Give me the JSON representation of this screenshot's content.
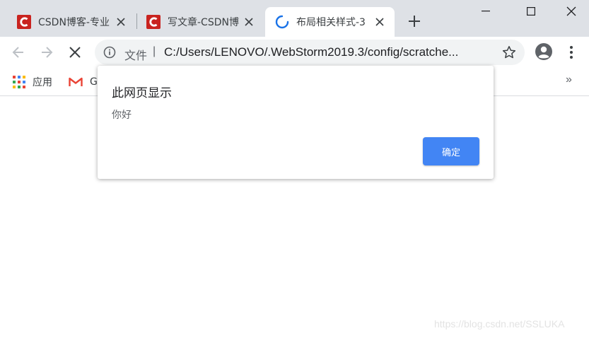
{
  "tabs": [
    {
      "title": "CSDN博客-专业",
      "favicon": "csdn-logo-icon",
      "active": false
    },
    {
      "title": "写文章-CSDN博",
      "favicon": "csdn-logo-icon",
      "active": false
    },
    {
      "title": "布局相关样式-3",
      "favicon": "loading-spinner-icon",
      "active": true
    }
  ],
  "toolbar": {
    "scheme_label": "文件",
    "separator": "|",
    "url": "C:/Users/LENOVO/.WebStorm2019.3/config/scratche..."
  },
  "bookmarks": [
    {
      "label": "应用",
      "icon": "apps-grid-icon"
    },
    {
      "label": "G",
      "icon": "gmail-icon"
    }
  ],
  "bookmarks_overflow": "»",
  "dialog": {
    "title": "此网页显示",
    "message": "你好",
    "ok_label": "确定"
  },
  "watermark": "https://blog.csdn.net/SSLUKA",
  "colors": {
    "accent": "#4285f4",
    "csdn_red": "#c9231f",
    "tabstrip_bg": "#dee1e6"
  }
}
